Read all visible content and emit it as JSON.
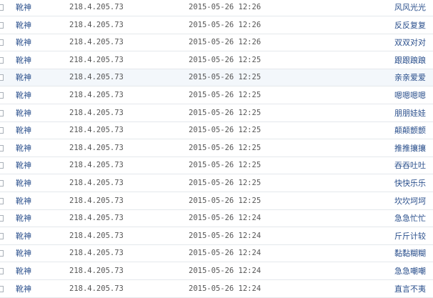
{
  "rows": [
    {
      "user": "靴神",
      "ip": "218.4.205.73",
      "time": "2015-05-26 12:26",
      "word": "风风光光"
    },
    {
      "user": "靴神",
      "ip": "218.4.205.73",
      "time": "2015-05-26 12:26",
      "word": "反反复复"
    },
    {
      "user": "靴神",
      "ip": "218.4.205.73",
      "time": "2015-05-26 12:26",
      "word": "双双对对"
    },
    {
      "user": "靴神",
      "ip": "218.4.205.73",
      "time": "2015-05-26 12:25",
      "word": "跟跟踉踉"
    },
    {
      "user": "靴神",
      "ip": "218.4.205.73",
      "time": "2015-05-26 12:25",
      "word": "亲亲爱爱"
    },
    {
      "user": "靴神",
      "ip": "218.4.205.73",
      "time": "2015-05-26 12:25",
      "word": "嗯嗯嗯嗯"
    },
    {
      "user": "靴神",
      "ip": "218.4.205.73",
      "time": "2015-05-26 12:25",
      "word": "朋朋娃娃"
    },
    {
      "user": "靴神",
      "ip": "218.4.205.73",
      "time": "2015-05-26 12:25",
      "word": "颠颠颤颤"
    },
    {
      "user": "靴神",
      "ip": "218.4.205.73",
      "time": "2015-05-26 12:25",
      "word": "推推攘攘"
    },
    {
      "user": "靴神",
      "ip": "218.4.205.73",
      "time": "2015-05-26 12:25",
      "word": "吞吞吐吐"
    },
    {
      "user": "靴神",
      "ip": "218.4.205.73",
      "time": "2015-05-26 12:25",
      "word": "快快乐乐"
    },
    {
      "user": "靴神",
      "ip": "218.4.205.73",
      "time": "2015-05-26 12:25",
      "word": "坎坎坷坷"
    },
    {
      "user": "靴神",
      "ip": "218.4.205.73",
      "time": "2015-05-26 12:24",
      "word": "急急忙忙"
    },
    {
      "user": "靴神",
      "ip": "218.4.205.73",
      "time": "2015-05-26 12:24",
      "word": "斤斤计较"
    },
    {
      "user": "靴神",
      "ip": "218.4.205.73",
      "time": "2015-05-26 12:24",
      "word": "黏黏糊糊"
    },
    {
      "user": "靴神",
      "ip": "218.4.205.73",
      "time": "2015-05-26 12:24",
      "word": "急急嘲嘲"
    },
    {
      "user": "靴神",
      "ip": "218.4.205.73",
      "time": "2015-05-26 12:24",
      "word": "直言不夷"
    }
  ],
  "highlight_row": 4,
  "colors": {
    "link": "#2a4f8c",
    "row_border": "#e4e8ec",
    "highlight_bg": "#f3f7fb"
  }
}
